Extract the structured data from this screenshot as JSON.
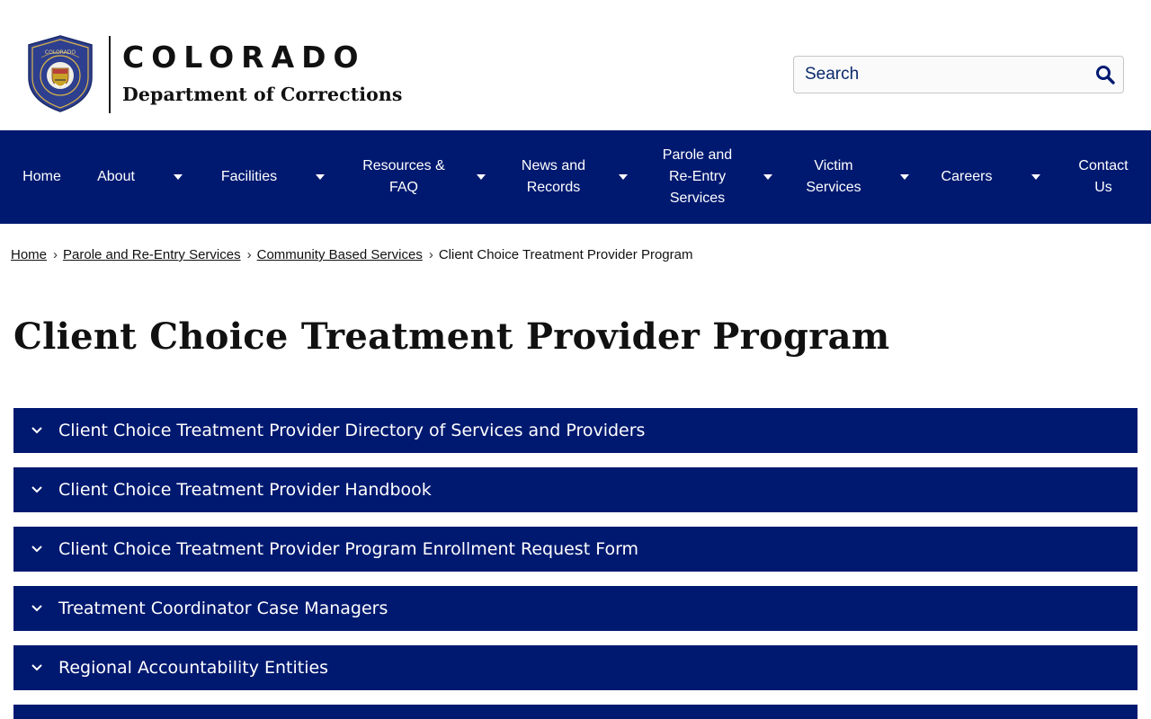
{
  "header": {
    "logo_word": "COLORADO",
    "logo_subtitle": "Department of Corrections",
    "seal_text": "COLORADO DEPARTMENT OF CORRECTIONS"
  },
  "search": {
    "placeholder": "Search",
    "icon": "search-icon"
  },
  "nav": {
    "items": [
      {
        "label": "Home",
        "has_dropdown": false
      },
      {
        "label": "About",
        "has_dropdown": true
      },
      {
        "label": "Facilities",
        "has_dropdown": true
      },
      {
        "label": "Resources & FAQ",
        "has_dropdown": true
      },
      {
        "label": "News and Records",
        "has_dropdown": true
      },
      {
        "label": "Parole and Re-Entry Services",
        "has_dropdown": true
      },
      {
        "label": "Victim Services",
        "has_dropdown": true
      },
      {
        "label": "Careers",
        "has_dropdown": true
      },
      {
        "label": "Contact Us",
        "has_dropdown": false
      }
    ]
  },
  "breadcrumb": {
    "items": [
      {
        "label": "Home",
        "link": true
      },
      {
        "label": "Parole and Re-Entry Services",
        "link": true
      },
      {
        "label": "Community Based Services",
        "link": true
      },
      {
        "label": "Client Choice Treatment Provider Program",
        "link": false
      }
    ],
    "separator": "›"
  },
  "page": {
    "title": "Client Choice Treatment Provider Program"
  },
  "accordions": [
    {
      "label": "Client Choice Treatment Provider Directory of Services and Providers"
    },
    {
      "label": "Client Choice Treatment Provider Handbook"
    },
    {
      "label": "Client Choice Treatment Provider Program Enrollment Request Form"
    },
    {
      "label": "Treatment Coordinator Case Managers"
    },
    {
      "label": "Regional Accountability Entities"
    },
    {
      "label": ""
    }
  ],
  "colors": {
    "brand_navy": "#001970",
    "seal_blue": "#2e3f8f",
    "seal_gold": "#c9a227"
  }
}
